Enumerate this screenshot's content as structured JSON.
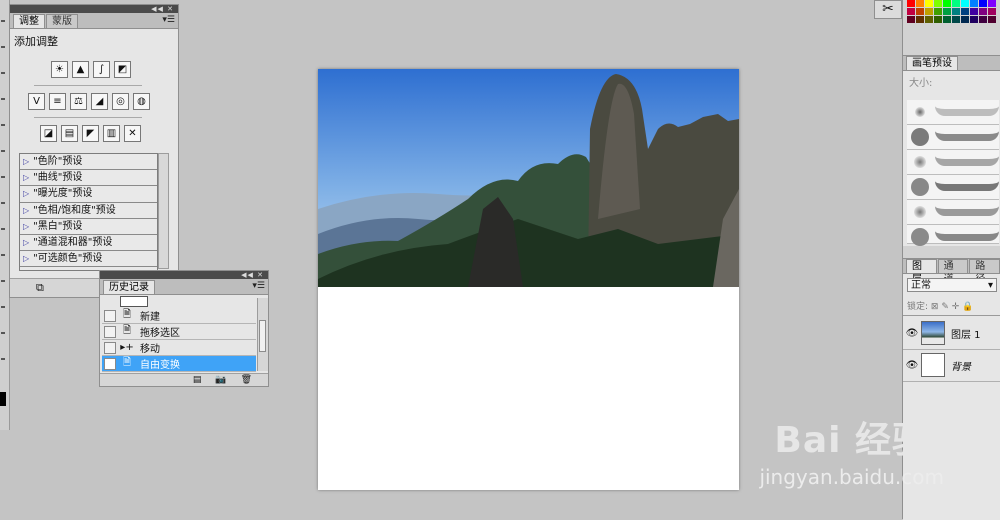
{
  "adjust_panel": {
    "tabs": [
      "调整",
      "蒙版"
    ],
    "title": "添加调整",
    "icon_rows": [
      [
        "brightness-icon",
        "levels-icon",
        "curves-icon",
        "exposure-icon"
      ],
      [
        "vibrance-icon",
        "hue-saturation-icon",
        "color-balance-icon",
        "black-white-icon",
        "photo-filter-icon",
        "channel-mixer-icon"
      ],
      [
        "invert-icon",
        "posterize-icon",
        "threshold-icon",
        "gradient-map-icon",
        "selective-color-icon"
      ]
    ],
    "presets": [
      "\"色阶\"预设",
      "\"曲线\"预设",
      "\"曝光度\"预设",
      "\"色相/饱和度\"预设",
      "\"黑白\"预设",
      "\"通道混和器\"预设",
      "\"可选颜色\"预设"
    ]
  },
  "history_panel": {
    "tab": "历史记录",
    "items": [
      {
        "label": "新建",
        "icon": "document-icon",
        "selected": false
      },
      {
        "label": "拖移选区",
        "icon": "document-icon",
        "selected": false
      },
      {
        "label": "移动",
        "icon": "move-icon",
        "selected": false
      },
      {
        "label": "自由变换",
        "icon": "document-icon",
        "selected": true
      }
    ]
  },
  "brush_panel": {
    "tab": "画笔预设",
    "size_label": "大小:"
  },
  "layers_panel": {
    "tabs": [
      "图层",
      "通道",
      "路径"
    ],
    "blend_mode": "正常",
    "lock_label": "锁定:",
    "layers": [
      {
        "name": "图层 1",
        "visible": true
      },
      {
        "name": "背景",
        "visible": true
      }
    ]
  },
  "watermark": {
    "logo": "Bai 经验",
    "url": "jingyan.baidu.com"
  },
  "colors": {
    "selection": "#3fa3f7",
    "workspace": "#c4c4c4"
  }
}
